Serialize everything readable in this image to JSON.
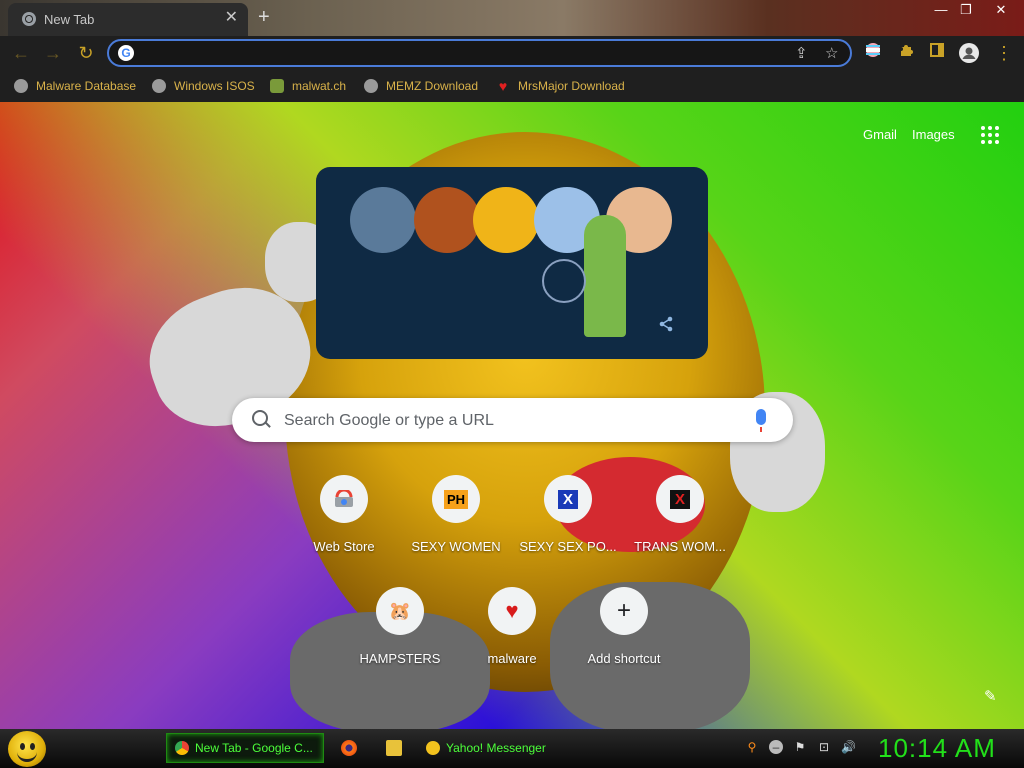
{
  "tab": {
    "title": "New Tab",
    "close_glyph": "✕",
    "new_tab_glyph": "+"
  },
  "window_controls": {
    "minimize": "—",
    "maximize": "❐",
    "close": "✕"
  },
  "toolbar": {
    "back": "←",
    "forward": "→",
    "reload": "↻",
    "address_value": "",
    "share_icon": "⇪",
    "star_icon": "☆",
    "extensions": [
      "flag-icon",
      "puzzle-icon",
      "sidepanel-icon",
      "profile-icon",
      "menu-icon"
    ],
    "menu_glyph": "⋮"
  },
  "bookmarks": [
    {
      "label": "Malware Database",
      "icon": "globe-icon"
    },
    {
      "label": "Windows ISOS",
      "icon": "globe-icon"
    },
    {
      "label": "malwat.ch",
      "icon": "android-icon"
    },
    {
      "label": "MEMZ Download",
      "icon": "globe-icon"
    },
    {
      "label": "MrsMajor Download",
      "icon": "heart-icon"
    }
  ],
  "top_links": {
    "gmail": "Gmail",
    "images": "Images"
  },
  "search": {
    "placeholder": "Search Google or type a URL"
  },
  "shortcuts": [
    {
      "label": "Web Store",
      "icon": "webstore-icon",
      "glyph": ""
    },
    {
      "label": "SEXY WOMEN",
      "icon": "ph-icon",
      "glyph": "PH"
    },
    {
      "label": "SEXY SEX PO...",
      "icon": "x-icon",
      "glyph": "X"
    },
    {
      "label": "TRANS WOM...",
      "icon": "x-icon",
      "glyph": "X"
    },
    {
      "label": "HAMPSTERS",
      "icon": "hamster-icon",
      "glyph": "🐹"
    },
    {
      "label": "malware",
      "icon": "heart-icon",
      "glyph": "♥"
    },
    {
      "label": "Add shortcut",
      "icon": "plus-icon",
      "glyph": "+"
    }
  ],
  "taskbar": {
    "tasks": [
      {
        "label": "New Tab - Google C...",
        "icon": "chrome-icon"
      },
      {
        "label": "Yahoo! Messenger",
        "icon": "yahoo-smiley-icon"
      }
    ],
    "clock": "10:14 AM"
  },
  "colors": {
    "accent_gold": "#c9a227",
    "bookmark_text": "#d9b24a",
    "taskbar_green": "#22e01a"
  }
}
